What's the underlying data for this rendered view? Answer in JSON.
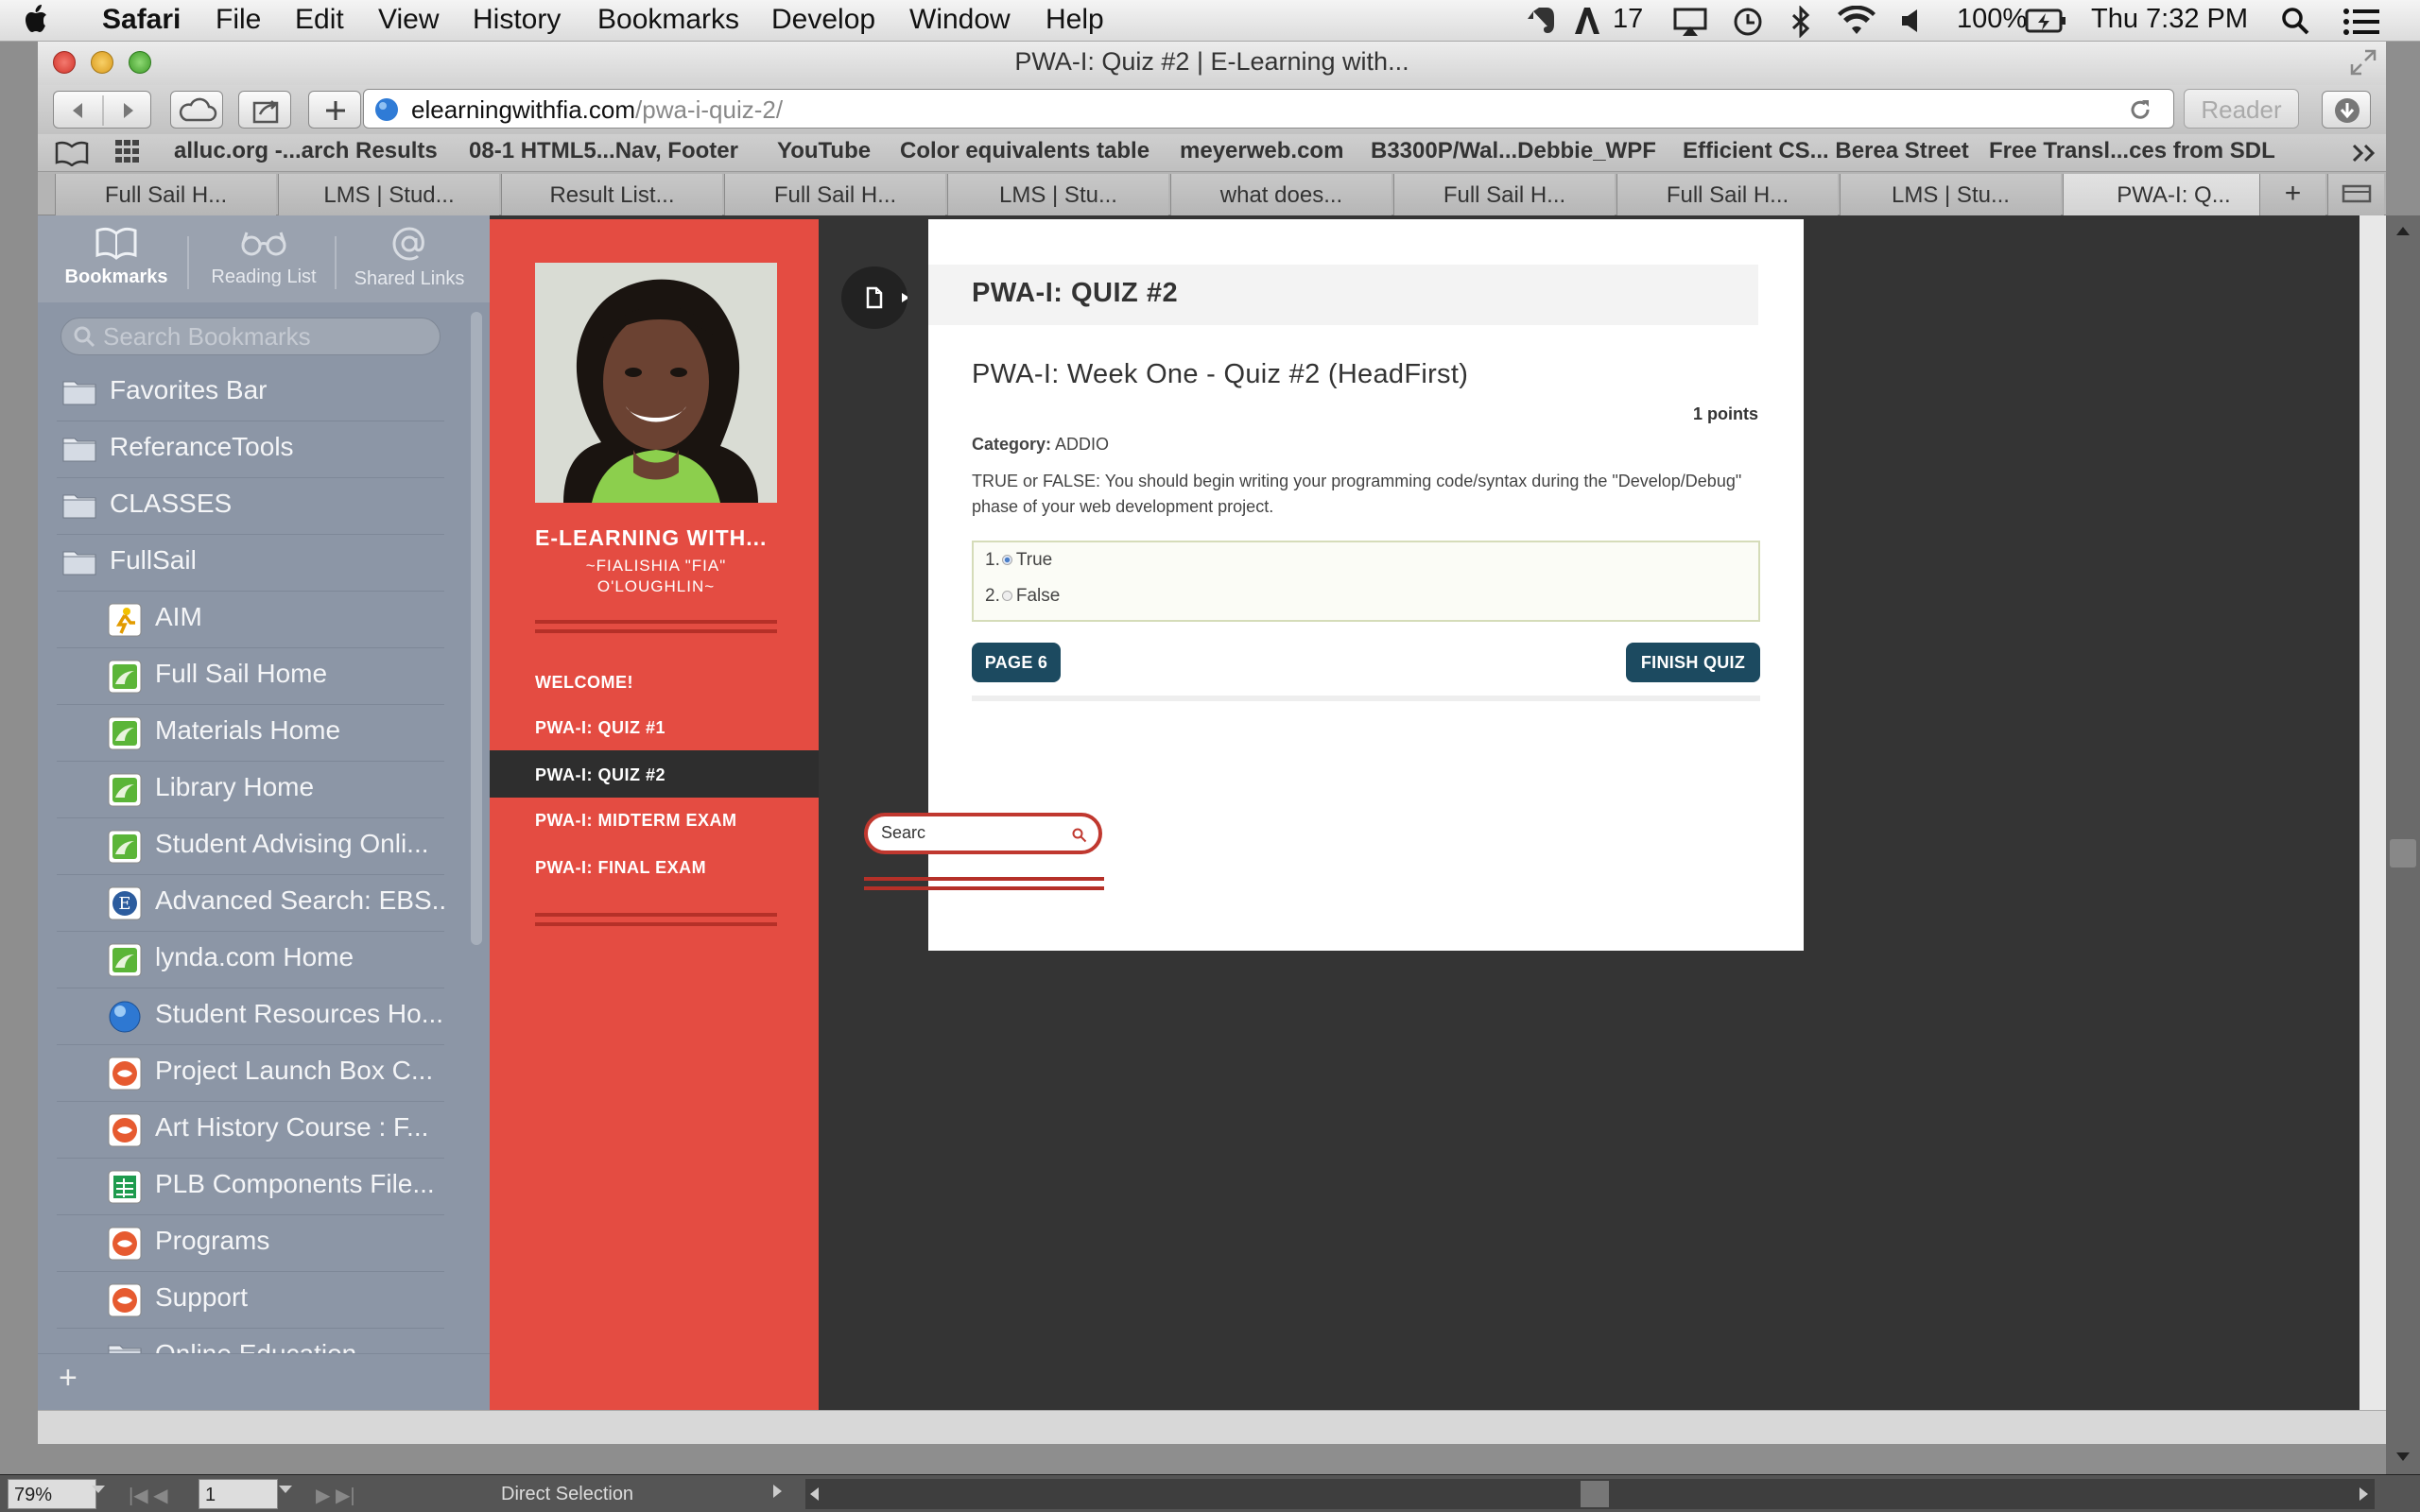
{
  "menubar": {
    "apple": "",
    "app": "Safari",
    "items": [
      "File",
      "Edit",
      "View",
      "History",
      "Bookmarks",
      "Develop",
      "Window",
      "Help"
    ],
    "status": {
      "badge": "17",
      "battery": "100%",
      "clock": "Thu 7:32 PM"
    }
  },
  "window": {
    "title": "PWA-I: Quiz #2 | E-Learning with...",
    "url_host": "elearningwithfia.com",
    "url_path": "/pwa-i-quiz-2/",
    "reader": "Reader"
  },
  "favorites": [
    "alluc.org -...arch Results",
    "08-1 HTML5...Nav, Footer",
    "YouTube",
    "Color equivalents table",
    "meyerweb.com",
    "B3300P/Wal...Debbie_WPF",
    "Efficient CS... Berea Street",
    "Free Transl...ces from SDL"
  ],
  "tabs": [
    "Full Sail H...",
    "LMS | Stud...",
    "Result List...",
    "Full Sail H...",
    "LMS | Stu...",
    "what does...",
    "Full Sail H...",
    "Full Sail H...",
    "LMS | Stu...",
    "PWA-I: Q..."
  ],
  "sidebar": {
    "tabs": [
      "Bookmarks",
      "Reading List",
      "Shared Links"
    ],
    "search_placeholder": "Search Bookmarks",
    "items": [
      {
        "label": "Favorites Bar",
        "icon": "folder-icon"
      },
      {
        "label": "ReferanceTools",
        "icon": "folder-icon"
      },
      {
        "label": "CLASSES",
        "icon": "folder-icon"
      },
      {
        "label": "FullSail",
        "icon": "folder-icon"
      },
      {
        "label": "AIM",
        "icon": "aim-icon"
      },
      {
        "label": "Full Sail Home",
        "icon": "page-icon"
      },
      {
        "label": "Materials Home",
        "icon": "page-icon"
      },
      {
        "label": "Library Home",
        "icon": "page-icon"
      },
      {
        "label": "Student Advising Onli...",
        "icon": "page-icon"
      },
      {
        "label": "Advanced Search: EBS...",
        "icon": "ebsco-icon"
      },
      {
        "label": "lynda.com Home",
        "icon": "page-icon"
      },
      {
        "label": "Student Resources Ho...",
        "icon": "globe-icon"
      },
      {
        "label": "Project Launch Box C...",
        "icon": "site-icon"
      },
      {
        "label": "Art History Course : F...",
        "icon": "site-icon"
      },
      {
        "label": "PLB Components File...",
        "icon": "sheet-icon"
      },
      {
        "label": "Programs",
        "icon": "site-icon"
      },
      {
        "label": "Support",
        "icon": "site-icon"
      },
      {
        "label": "Online Education",
        "icon": "folder-icon"
      }
    ],
    "add": "+"
  },
  "site": {
    "title": "E-LEARNING WITH...",
    "subtitle": "~FIALISHIA \"FIA\" O'LOUGHLIN~",
    "nav": [
      "WELCOME!",
      "PWA-I: QUIZ #1",
      "PWA-I: QUIZ #2",
      "PWA-I: MIDTERM EXAM",
      "PWA-I: FINAL EXAM"
    ],
    "search_value": "Searc"
  },
  "quiz": {
    "header": "PWA-I: QUIZ #2",
    "title": "PWA-I: Week One - Quiz #2 (HeadFirst)",
    "points": "1 points",
    "category_label": "Category:",
    "category": "ADDIO",
    "question": "TRUE or FALSE:  You should begin writing your programming code/syntax during the \"Develop/Debug\" phase of your web development project.",
    "answers": [
      {
        "num": "1.",
        "label": "True",
        "selected": true
      },
      {
        "num": "2.",
        "label": "False",
        "selected": false
      }
    ],
    "prev_button": "PAGE 6",
    "finish_button": "FINISH QUIZ"
  },
  "statusbar": {
    "zoom": "79%",
    "page": "1",
    "tool": "Direct Selection"
  },
  "colors": {
    "accent": "#e44c42",
    "dark": "#343434",
    "button": "#1c4a60",
    "sidebar": "#8c96a6"
  }
}
